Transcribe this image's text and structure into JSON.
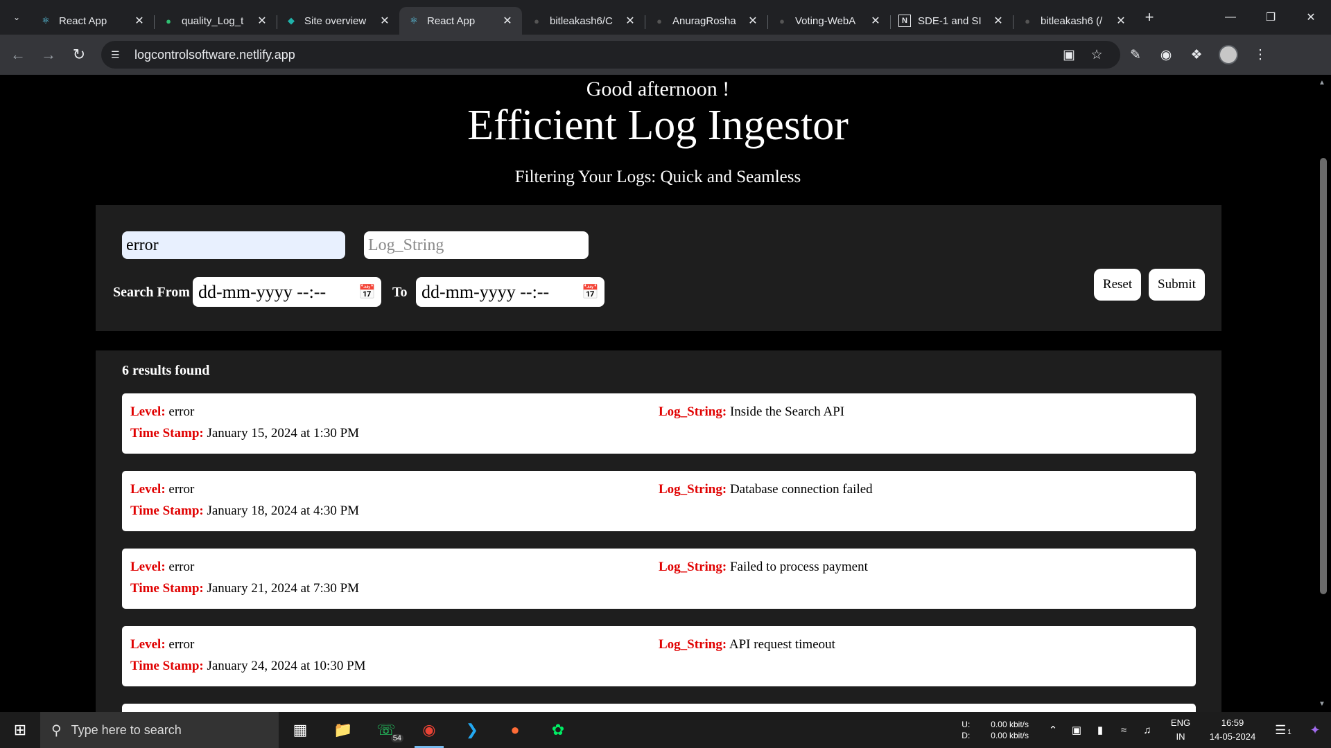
{
  "browser": {
    "tabs": [
      {
        "title": "React App",
        "icon": "react-icon",
        "active": false
      },
      {
        "title": "quality_Log_t",
        "icon": "netlify-deploy-icon",
        "active": false
      },
      {
        "title": "Site overview",
        "icon": "netlify-icon",
        "active": false
      },
      {
        "title": "React App",
        "icon": "react-icon",
        "active": true
      },
      {
        "title": "bitleakash6/C",
        "icon": "github-icon",
        "active": false
      },
      {
        "title": "AnuragRosha",
        "icon": "github-icon",
        "active": false
      },
      {
        "title": "Voting-WebA",
        "icon": "github-icon",
        "active": false
      },
      {
        "title": "SDE-1 and SI",
        "icon": "notion-icon",
        "active": false
      },
      {
        "title": "bitleakash6 (/",
        "icon": "github-icon",
        "active": false
      }
    ],
    "url": "logcontrolsoftware.netlify.app"
  },
  "page": {
    "greeting": "Good afternoon !",
    "title": "Efficient Log Ingestor",
    "subtitle": "Filtering Your Logs: Quick and Seamless"
  },
  "filters": {
    "level_value": "error",
    "log_string_placeholder": "Log_String",
    "search_from_label": "Search From",
    "to_label": "To",
    "from_date_text": "dd-mm-yyyy --:--",
    "to_date_text": "dd-mm-yyyy --:--",
    "reset_label": "Reset",
    "submit_label": "Submit"
  },
  "results": {
    "count_text": "6 results found",
    "level_key": "Level:",
    "timestamp_key": "Time Stamp:",
    "logstring_key": "Log_String:",
    "items": [
      {
        "level": "error",
        "timestamp": "January 15, 2024 at 1:30 PM",
        "log_string": "Inside the Search API"
      },
      {
        "level": "error",
        "timestamp": "January 18, 2024 at 4:30 PM",
        "log_string": "Database connection failed"
      },
      {
        "level": "error",
        "timestamp": "January 21, 2024 at 7:30 PM",
        "log_string": "Failed to process payment"
      },
      {
        "level": "error",
        "timestamp": "January 24, 2024 at 10:30 PM",
        "log_string": "API request timeout"
      }
    ]
  },
  "taskbar": {
    "search_placeholder": "Type here to search",
    "whatsapp_badge": "54",
    "upload_label": "U:",
    "download_label": "D:",
    "upload_speed": "0.00 kbit/s",
    "download_speed": "0.00 kbit/s",
    "lang": "ENG",
    "region": "IN",
    "time": "16:59",
    "date": "14-05-2024",
    "notification_count": "1"
  },
  "colors": {
    "accent_red": "#e00000",
    "panel_bg": "#1e1e1e",
    "autofill_bg": "#e8f0fe"
  }
}
